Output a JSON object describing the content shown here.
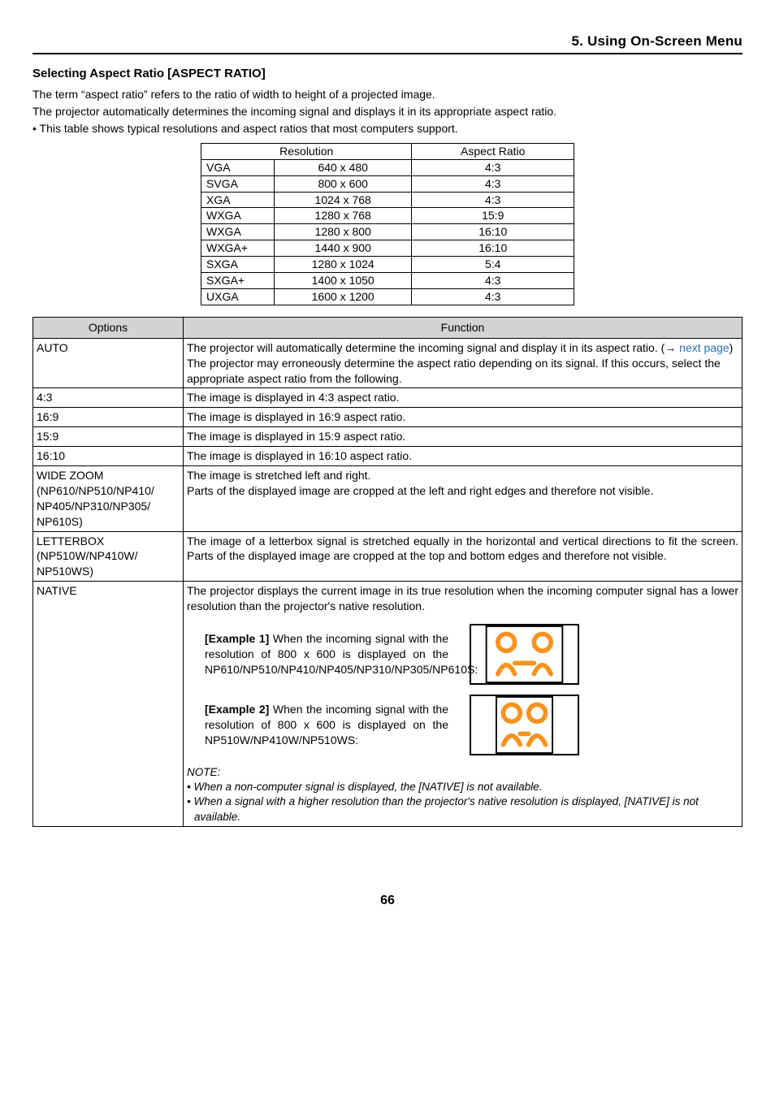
{
  "header": {
    "title": "5. Using On-Screen Menu"
  },
  "section": {
    "title": "Selecting Aspect Ratio [ASPECT RATIO]",
    "p1": "The term “aspect ratio” refers to the ratio of width to height of a projected image.",
    "p2": "The projector automatically determines the incoming signal and displays it in its appropriate aspect ratio.",
    "bullet": "• This table shows typical resolutions and aspect ratios that most computers support."
  },
  "res_table": {
    "headers": [
      "Resolution",
      "Aspect Ratio"
    ],
    "rows": [
      {
        "name": "VGA",
        "val": "640 x 480",
        "ratio": "4:3"
      },
      {
        "name": "SVGA",
        "val": "800 x 600",
        "ratio": "4:3"
      },
      {
        "name": "XGA",
        "val": "1024 x 768",
        "ratio": "4:3"
      },
      {
        "name": "WXGA",
        "val": "1280 x 768",
        "ratio": "15:9"
      },
      {
        "name": "WXGA",
        "val": "1280 x 800",
        "ratio": "16:10"
      },
      {
        "name": "WXGA+",
        "val": "1440 x 900",
        "ratio": "16:10"
      },
      {
        "name": "SXGA",
        "val": "1280 x 1024",
        "ratio": "5:4"
      },
      {
        "name": "SXGA+",
        "val": "1400 x 1050",
        "ratio": "4:3"
      },
      {
        "name": "UXGA",
        "val": "1600 x 1200",
        "ratio": "4:3"
      }
    ]
  },
  "opt_table": {
    "headers": {
      "options": "Options",
      "function": "Function"
    },
    "auto": {
      "label": "AUTO",
      "l1a": "The projector will automatically determine the incoming signal and display it in its aspect ratio. (",
      "l1arrow": "→ ",
      "l1link": "next page",
      "l1b": ")",
      "l2": "The projector may erroneously determine the aspect ratio depending on its signal. If this occurs, select the appropriate aspect ratio from the following."
    },
    "r43": {
      "label": "4:3",
      "fn": "The image is displayed in 4:3 aspect ratio."
    },
    "r169": {
      "label": "16:9",
      "fn": "The image is displayed in 16:9 aspect ratio."
    },
    "r159": {
      "label": "15:9",
      "fn": "The image is displayed in 15:9 aspect ratio."
    },
    "r1610": {
      "label": "16:10",
      "fn": "The image is displayed in 16:10 aspect ratio."
    },
    "wide": {
      "label": "WIDE ZOOM\n(NP610/NP510/NP410/\nNP405/NP310/NP305/\nNP610S)",
      "l1": "The image is stretched left and right.",
      "l2": "Parts of the displayed image are cropped at the left and right edges and therefore not visible."
    },
    "letter": {
      "label": "LETTERBOX\n(NP510W/NP410W/\nNP510WS)",
      "fn": "The image of a letterbox signal is stretched equally in the horizontal and vertical directions to fit the screen. Parts of the displayed image are cropped at the top and bottom edges and therefore not visible."
    },
    "native": {
      "label": "NATIVE",
      "intro": "The projector displays the current image in its true resolution when the incoming computer signal has a lower resolution than the projector's native resolution.",
      "ex1_bold": "[Example 1]",
      "ex1_text": " When the incoming signal with the resolution of 800 x 600 is displayed on the NP610/NP510/NP410/NP405/NP310/NP305/NP610S:",
      "ex2_bold": "[Example 2]",
      "ex2_text": " When the incoming signal with the resolution of 800 x 600 is displayed on the NP510W/NP410W/NP510WS:",
      "note_title": "NOTE:",
      "note1": "• When a non-computer signal is displayed, the [NATIVE] is not available.",
      "note2": "• When a signal with a higher resolution than the projector's native resolution is displayed, [NATIVE] is not available."
    }
  },
  "page_number": "66"
}
